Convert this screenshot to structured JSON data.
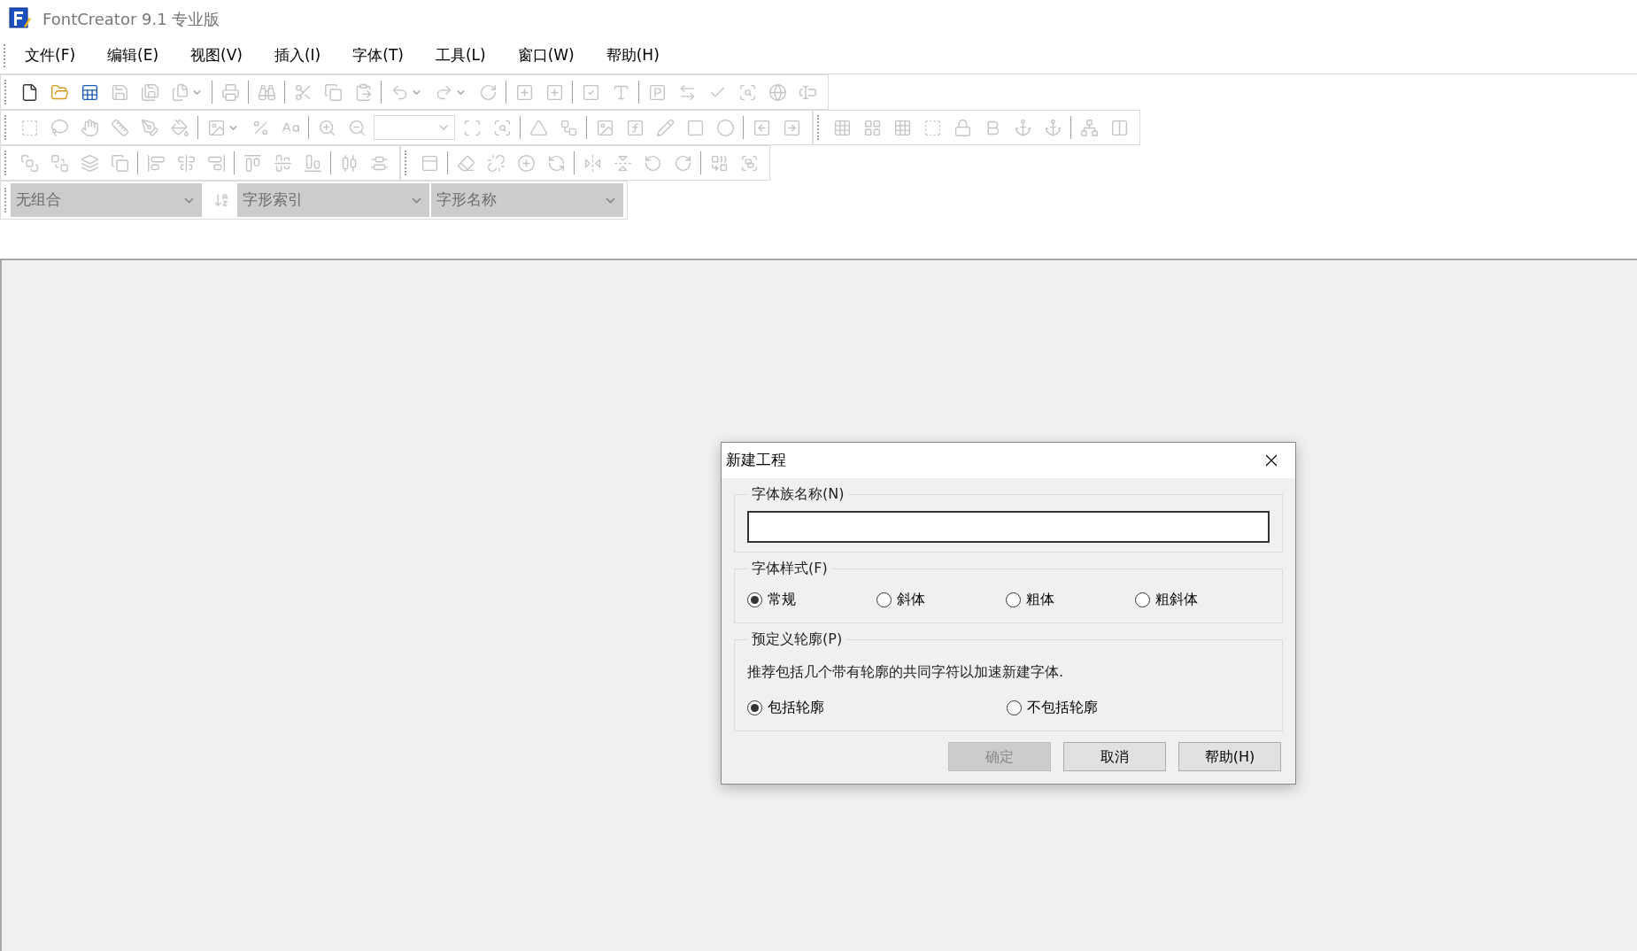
{
  "window": {
    "title": "FontCreator 9.1 专业版"
  },
  "menu": [
    "文件(F)",
    "编辑(E)",
    "视图(V)",
    "插入(I)",
    "字体(T)",
    "工具(L)",
    "窗口(W)",
    "帮助(H)"
  ],
  "toolbars": [
    {
      "buttons": [
        {
          "disabled": false
        },
        {
          "disabled": false
        },
        {
          "disabled": false
        },
        {
          "disabled": true
        },
        {
          "disabled": true
        },
        {
          "disabled": true
        },
        {
          "disabled": true
        },
        {
          "disabled": true
        },
        {
          "disabled": true
        },
        {
          "disabled": true
        },
        {
          "disabled": true
        },
        {
          "disabled": true
        },
        {
          "disabled": true
        },
        {
          "disabled": true
        },
        {
          "disabled": true
        },
        {
          "disabled": true
        },
        {
          "disabled": true
        },
        {
          "disabled": true
        },
        {
          "disabled": true
        },
        {
          "disabled": true
        },
        {
          "disabled": true
        },
        {
          "disabled": true
        },
        {
          "disabled": true
        },
        {
          "disabled": true
        }
      ]
    },
    {
      "buttons": [
        {
          "disabled": true
        },
        {
          "disabled": true
        },
        {
          "disabled": true
        },
        {
          "disabled": true
        },
        {
          "disabled": true
        },
        {
          "disabled": true
        },
        {
          "disabled": true
        },
        {
          "disabled": true
        },
        {
          "disabled": true
        },
        {
          "disabled": true
        },
        {
          "disabled": true
        },
        {
          "disabled": true
        },
        {
          "disabled": true
        },
        {
          "disabled": true
        },
        {
          "disabled": true
        },
        {
          "disabled": true
        },
        {
          "disabled": true
        },
        {
          "disabled": true
        },
        {
          "disabled": true
        },
        {
          "disabled": true
        },
        {
          "disabled": true
        },
        {
          "disabled": true
        },
        {
          "disabled": true
        },
        {
          "disabled": true
        },
        {
          "disabled": true
        },
        {
          "disabled": true
        },
        {
          "disabled": true
        },
        {
          "disabled": true
        },
        {
          "disabled": true
        },
        {
          "disabled": true
        },
        {
          "disabled": true
        },
        {
          "disabled": true
        }
      ],
      "zoom_field": {
        "disabled": true
      }
    },
    {
      "buttons": [
        {
          "disabled": true
        },
        {
          "disabled": true
        },
        {
          "disabled": true
        },
        {
          "disabled": true
        },
        {
          "disabled": true
        },
        {
          "disabled": true
        },
        {
          "disabled": true
        },
        {
          "disabled": true
        },
        {
          "disabled": true
        },
        {
          "disabled": true
        },
        {
          "disabled": true
        },
        {
          "disabled": true
        },
        {
          "disabled": true
        },
        {
          "disabled": true
        },
        {
          "disabled": true
        },
        {
          "disabled": true
        },
        {
          "disabled": true
        },
        {
          "disabled": true
        },
        {
          "disabled": true
        },
        {
          "disabled": true
        },
        {
          "disabled": true
        },
        {
          "disabled": true
        },
        {
          "disabled": true
        }
      ]
    }
  ],
  "selectors": [
    {
      "value": "无组合",
      "disabled": true
    },
    {
      "value": "字形索引",
      "disabled": true
    },
    {
      "value": "字形名称",
      "disabled": true
    }
  ],
  "sort_button": {
    "disabled": true
  },
  "dialog": {
    "title": "新建工程",
    "family_name": {
      "label": "字体族名称(N)"
    },
    "style": {
      "label": "字体样式(F)",
      "options": [
        {
          "label": "常规",
          "selected": true
        },
        {
          "label": "斜体",
          "selected": false
        },
        {
          "label": "粗体",
          "selected": false
        },
        {
          "label": "粗斜体",
          "selected": false
        }
      ]
    },
    "outlines": {
      "label": "预定义轮廓(P)",
      "description": "推荐包括几个带有轮廓的共同字符以加速新建字体.",
      "options": [
        {
          "label": "包括轮廓",
          "selected": true
        },
        {
          "label": "不包括轮廓",
          "selected": false
        }
      ]
    },
    "buttons": [
      {
        "label": "确定",
        "disabled": true
      },
      {
        "label": "取消",
        "disabled": false
      },
      {
        "label": "帮助(H)",
        "disabled": false
      }
    ]
  }
}
